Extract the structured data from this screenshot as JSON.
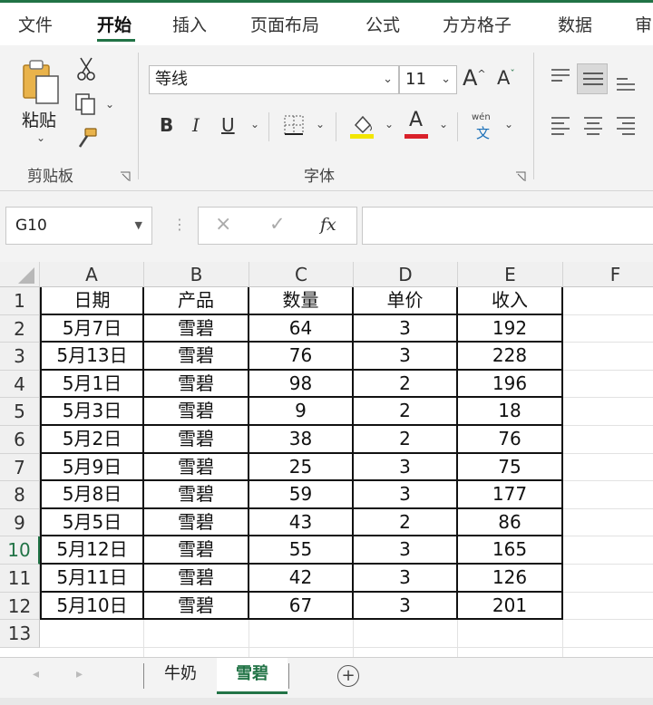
{
  "menu": {
    "tabs": [
      "文件",
      "开始",
      "插入",
      "页面布局",
      "公式",
      "方方格子",
      "数据",
      "审"
    ],
    "active": "开始"
  },
  "ribbon": {
    "clipboard": {
      "paste_label": "粘贴",
      "group_label": "剪贴板"
    },
    "font": {
      "font_name": "等线",
      "font_size": "11",
      "bold": "B",
      "italic": "I",
      "underline": "U",
      "font_color_glyph": "A",
      "grow_glyph": "A",
      "shrink_glyph": "A",
      "phonetic_top": "wén",
      "phonetic_bottom": "文",
      "group_label": "字体",
      "highlight_color": "#f2e600",
      "font_color": "#d9202a"
    }
  },
  "formula_bar": {
    "name_box": "G10",
    "cancel": "×",
    "enter": "✓",
    "fx": "fx",
    "value": ""
  },
  "grid": {
    "columns": [
      "A",
      "B",
      "C",
      "D",
      "E",
      "F"
    ],
    "row_numbers": [
      "1",
      "2",
      "3",
      "4",
      "5",
      "6",
      "7",
      "8",
      "9",
      "10",
      "11",
      "12",
      "13"
    ],
    "selected_row": "10",
    "header": [
      "日期",
      "产品",
      "数量",
      "单价",
      "收入"
    ],
    "rows": [
      [
        "5月7日",
        "雪碧",
        "64",
        "3",
        "192"
      ],
      [
        "5月13日",
        "雪碧",
        "76",
        "3",
        "228"
      ],
      [
        "5月1日",
        "雪碧",
        "98",
        "2",
        "196"
      ],
      [
        "5月3日",
        "雪碧",
        "9",
        "2",
        "18"
      ],
      [
        "5月2日",
        "雪碧",
        "38",
        "2",
        "76"
      ],
      [
        "5月9日",
        "雪碧",
        "25",
        "3",
        "75"
      ],
      [
        "5月8日",
        "雪碧",
        "59",
        "3",
        "177"
      ],
      [
        "5月5日",
        "雪碧",
        "43",
        "2",
        "86"
      ],
      [
        "5月12日",
        "雪碧",
        "55",
        "3",
        "165"
      ],
      [
        "5月11日",
        "雪碧",
        "42",
        "3",
        "126"
      ],
      [
        "5月10日",
        "雪碧",
        "67",
        "3",
        "201"
      ]
    ]
  },
  "sheets": {
    "tabs": [
      "牛奶",
      "雪碧"
    ],
    "active": "雪碧",
    "add": "+"
  },
  "colors": {
    "accent": "#217346"
  }
}
